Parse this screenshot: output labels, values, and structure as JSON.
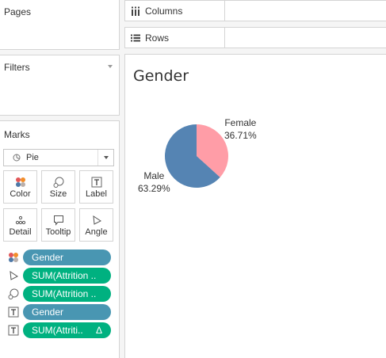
{
  "panels": {
    "pages": "Pages",
    "filters": "Filters",
    "marks": "Marks"
  },
  "marks_type": "Pie",
  "mark_buttons": {
    "color": "Color",
    "size": "Size",
    "label": "Label",
    "detail": "Detail",
    "tooltip": "Tooltip",
    "angle": "Angle"
  },
  "mark_fields": [
    {
      "text": "Gender",
      "kind": "color",
      "pill": "dimension"
    },
    {
      "text": "SUM(Attrition ..",
      "kind": "angle",
      "pill": "measure"
    },
    {
      "text": "SUM(Attrition ..",
      "kind": "size",
      "pill": "measure"
    },
    {
      "text": "Gender",
      "kind": "label",
      "pill": "dimension"
    },
    {
      "text": "SUM(Attriti..",
      "kind": "label",
      "pill": "measure",
      "suffix": "Δ"
    }
  ],
  "shelves": {
    "columns": "Columns",
    "rows": "Rows"
  },
  "colors": {
    "dimension_pill": "#4996b2",
    "measure_pill": "#00b180",
    "male": "#5584b3",
    "female": "#ff9da7"
  },
  "chart_data": {
    "type": "pie",
    "title": "Gender",
    "slices": [
      {
        "label": "Female",
        "value": 36.71,
        "value_label": "36.71%",
        "color": "#ff9da7"
      },
      {
        "label": "Male",
        "value": 63.29,
        "value_label": "63.29%",
        "color": "#5584b3"
      }
    ]
  }
}
